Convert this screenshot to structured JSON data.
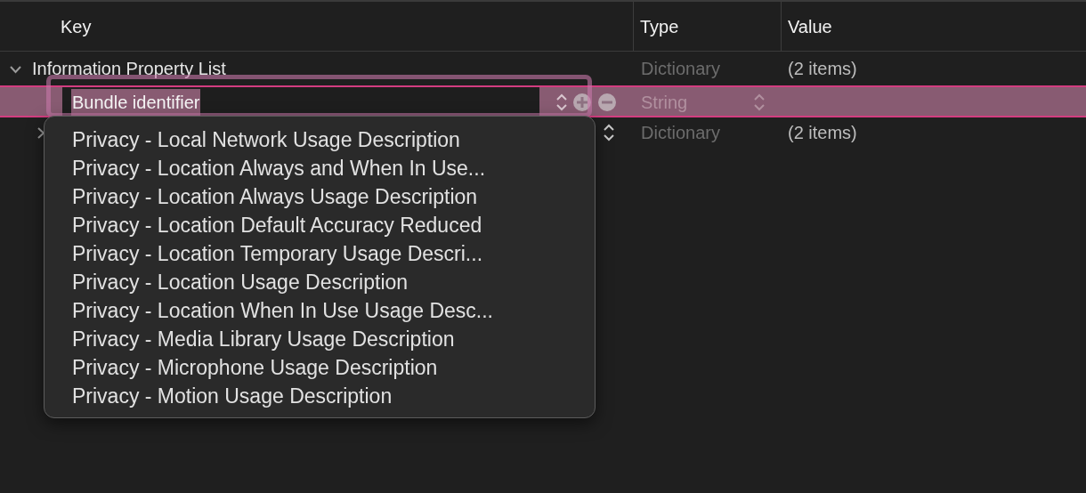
{
  "columns": [
    {
      "label": "Key"
    },
    {
      "label": "Type"
    },
    {
      "label": "Value"
    }
  ],
  "rows": [
    {
      "kind": "group",
      "key": "Information Property List",
      "type": "Dictionary",
      "value": "(2 items)",
      "expanded": true,
      "selected": false
    },
    {
      "kind": "editing",
      "key_field": {
        "value": "Bundle identifier"
      },
      "type": "String",
      "selected": true
    },
    {
      "kind": "group",
      "type": "Dictionary",
      "value": "(2 items)",
      "expanded": false,
      "selected": false
    }
  ],
  "suggestions": [
    "Privacy - Local Network Usage Description",
    "Privacy - Location Always and When In Use...",
    "Privacy - Location Always Usage Description",
    "Privacy - Location Default Accuracy Reduced",
    "Privacy - Location Temporary Usage Descri...",
    "Privacy - Location Usage Description",
    "Privacy - Location When In Use Usage Desc...",
    "Privacy - Media Library Usage Description",
    "Privacy - Microphone Usage Description",
    "Privacy - Motion Usage Description"
  ]
}
